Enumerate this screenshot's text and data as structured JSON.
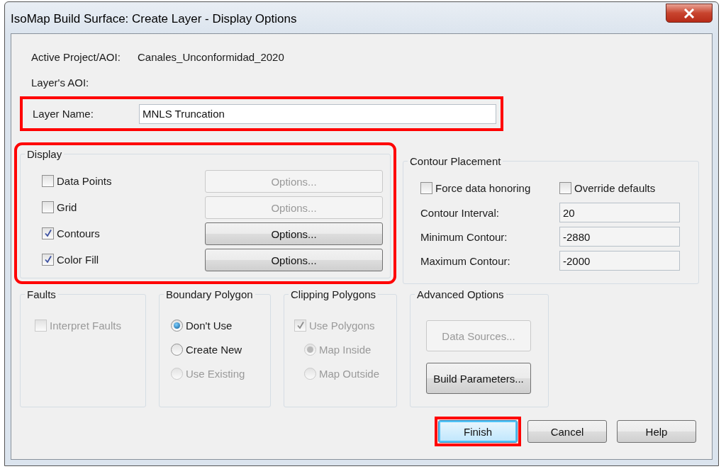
{
  "window": {
    "title": "IsoMap Build Surface: Create Layer - Display Options"
  },
  "project": {
    "label": "Active Project/AOI:",
    "value": "Canales_Unconformidad_2020"
  },
  "layer_aoi": {
    "label": "Layer's AOI:"
  },
  "layer_name": {
    "label": "Layer Name:",
    "value": "MNLS Truncation",
    "highlighted": true
  },
  "display": {
    "title": "Display",
    "highlighted": true,
    "items": [
      {
        "label": "Data Points",
        "checked": false,
        "button": "Options...",
        "button_disabled": true
      },
      {
        "label": "Grid",
        "checked": false,
        "button": "Options...",
        "button_disabled": true
      },
      {
        "label": "Contours",
        "checked": true,
        "button": "Options...",
        "button_disabled": false
      },
      {
        "label": "Color Fill",
        "checked": true,
        "button": "Options...",
        "button_disabled": false
      }
    ]
  },
  "contour_placement": {
    "title": "Contour Placement",
    "checkboxes": [
      {
        "label": "Force data honoring",
        "checked": false
      },
      {
        "label": "Override defaults",
        "checked": false
      }
    ],
    "fields": [
      {
        "label": "Contour Interval:",
        "value": "20"
      },
      {
        "label": "Minimum Contour:",
        "value": "-2880"
      },
      {
        "label": "Maximum Contour:",
        "value": "-2000"
      }
    ]
  },
  "faults": {
    "title": "Faults",
    "checkbox": {
      "label": "Interpret Faults",
      "checked": false,
      "disabled": true
    }
  },
  "boundary_polygon": {
    "title": "Boundary Polygon",
    "options": [
      {
        "label": "Don't Use",
        "selected": true,
        "disabled": false
      },
      {
        "label": "Create New",
        "selected": false,
        "disabled": false
      },
      {
        "label": "Use Existing",
        "selected": false,
        "disabled": true
      }
    ]
  },
  "clipping_polygons": {
    "title": "Clipping Polygons",
    "checkbox": {
      "label": "Use Polygons",
      "checked": true,
      "disabled": true
    },
    "options": [
      {
        "label": "Map Inside",
        "selected": true,
        "disabled": true
      },
      {
        "label": "Map Outside",
        "selected": false,
        "disabled": true
      }
    ]
  },
  "advanced_options": {
    "title": "Advanced Options",
    "buttons": [
      {
        "label": "Data Sources...",
        "disabled": true
      },
      {
        "label": "Build Parameters...",
        "disabled": false
      }
    ]
  },
  "buttons": [
    {
      "label": "Finish",
      "default": true,
      "highlighted": true
    },
    {
      "label": "Cancel",
      "default": false,
      "highlighted": false
    },
    {
      "label": "Help",
      "default": false,
      "highlighted": false
    }
  ]
}
